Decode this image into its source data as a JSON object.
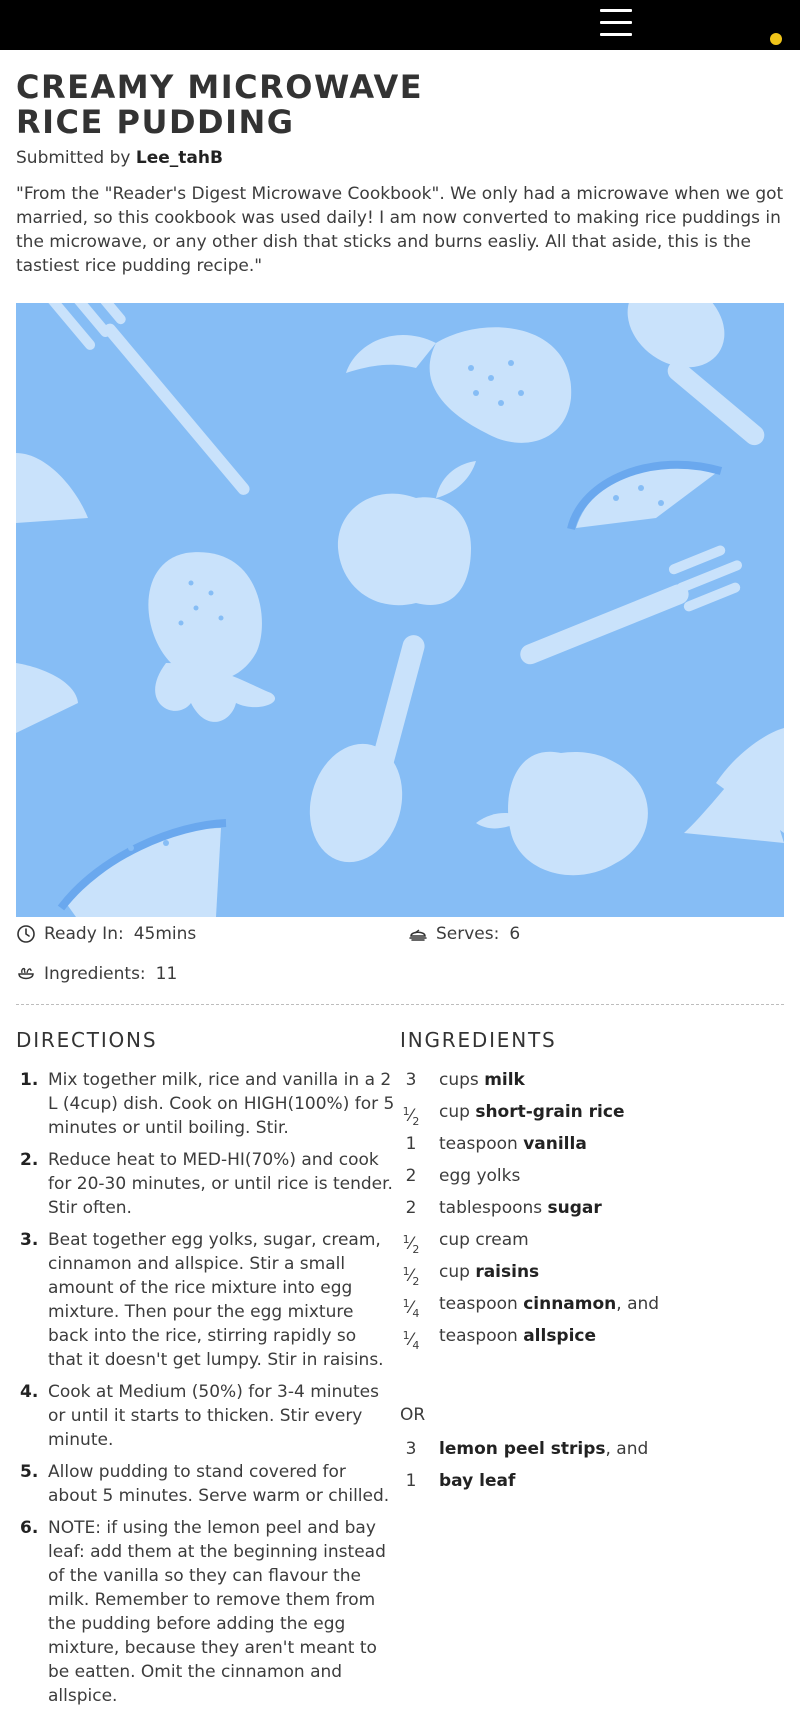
{
  "header": {
    "menu_icon": "hamburger-menu-icon",
    "notification_dot_color": "#f0c419"
  },
  "recipe": {
    "title": "CREAMY MICROWAVE RICE PUDDING",
    "submitted_prefix": "Submitted by",
    "author": "Lee_tahB",
    "description": "\"From the \"Reader's Digest Microwave Cookbook\". We only had a microwave when we got married, so this cookbook was used daily! I am now converted to making rice puddings in the microwave, or any other dish that sticks and burns easliy. All that aside, this is the tastiest rice pudding recipe.\"",
    "hero_background_color": "#86bdf5"
  },
  "meta": {
    "ready_label": "Ready In:",
    "ready_value": "45mins",
    "serves_label": "Serves:",
    "serves_value": "6",
    "ingredients_label": "Ingredients:",
    "ingredients_value": "11"
  },
  "directions": {
    "heading": "DIRECTIONS",
    "steps": [
      {
        "num": "1.",
        "text": "Mix together milk, rice and vanilla in a 2 L (4cup) dish. Cook on HIGH(100%) for 5 minutes or until boiling. Stir."
      },
      {
        "num": "2.",
        "text": "Reduce heat to MED-HI(70%) and cook for 20-30 minutes, or until rice is tender. Stir often."
      },
      {
        "num": "3.",
        "text": "Beat together egg yolks, sugar, cream, cinnamon and allspice. Stir a small amount of the rice mixture into egg mixture. Then pour the egg mixture back into the rice, stirring rapidly so that it doesn't get lumpy. Stir in raisins."
      },
      {
        "num": "4.",
        "text": "Cook at Medium (50%) for 3-4 minutes or until it starts to thicken. Stir every minute."
      },
      {
        "num": "5.",
        "text": "Allow pudding to stand covered for about 5 minutes. Serve warm or chilled."
      },
      {
        "num": "6.",
        "text": "NOTE: if using the lemon peel and bay leaf: add them at the beginning instead of the vanilla so they can flavour the milk. Remember to remove them from the pudding before adding the egg mixture, because they aren't meant to be eatten. Omit the cinnamon and allspice."
      }
    ]
  },
  "ingredients": {
    "heading": "INGREDIENTS",
    "items": [
      {
        "qty": "3",
        "unit": "cups",
        "name": "milk",
        "suffix": ""
      },
      {
        "qty_num": "1",
        "qty_den": "2",
        "unit": "cup",
        "name": "short-grain rice",
        "suffix": ""
      },
      {
        "qty": "1",
        "unit": "teaspoon",
        "name": "vanilla",
        "suffix": ""
      },
      {
        "qty": "2",
        "unit": "egg yolks",
        "name": "",
        "suffix": ""
      },
      {
        "qty": "2",
        "unit": "tablespoons",
        "name": "sugar",
        "suffix": ""
      },
      {
        "qty_num": "1",
        "qty_den": "2",
        "unit": "cup cream",
        "name": "",
        "suffix": ""
      },
      {
        "qty_num": "1",
        "qty_den": "2",
        "unit": "cup",
        "name": "raisins",
        "suffix": ""
      },
      {
        "qty_num": "1",
        "qty_den": "4",
        "unit": "teaspoon",
        "name": "cinnamon",
        "suffix": ", and"
      },
      {
        "qty_num": "1",
        "qty_den": "4",
        "unit": "teaspoon",
        "name": "allspice",
        "suffix": ""
      }
    ],
    "or_label": "OR",
    "alt_items": [
      {
        "qty": "3",
        "name": "lemon peel strips",
        "suffix": ", and"
      },
      {
        "qty": "1",
        "name": "bay leaf",
        "suffix": ""
      }
    ]
  }
}
